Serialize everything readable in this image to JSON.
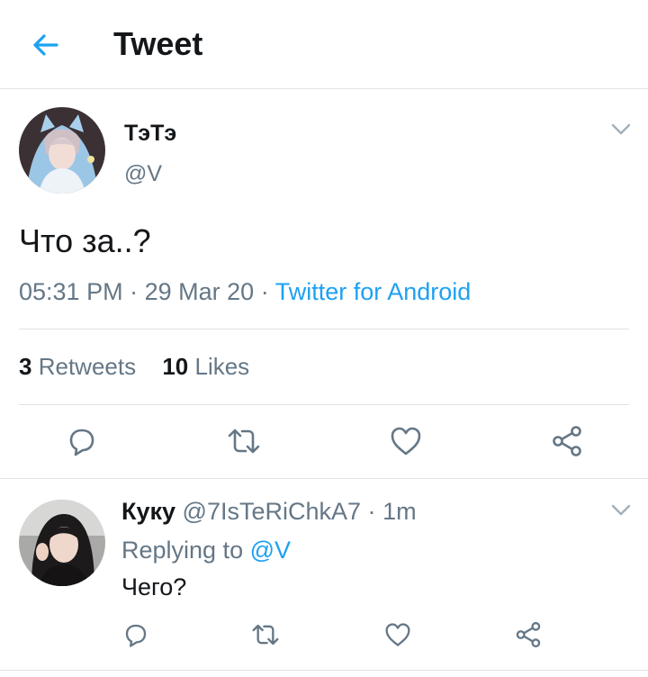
{
  "header": {
    "title": "Tweet",
    "back_icon": "arrow-left-icon"
  },
  "tweet": {
    "author": {
      "display_name": "ТэТэ",
      "handle": "@V"
    },
    "text": "Что за..?",
    "time": "05:31 PM",
    "separator": "·",
    "date": "29 Mar 20",
    "source": "Twitter for Android",
    "stats": {
      "retweets_count": "3",
      "retweets_label": "Retweets",
      "likes_count": "10",
      "likes_label": "Likes"
    },
    "actions": [
      "reply-icon",
      "retweet-icon",
      "like-icon",
      "share-icon"
    ]
  },
  "reply": {
    "author": {
      "display_name": "Куку",
      "handle": "@7IsTeRiChkA7"
    },
    "separator": "·",
    "time": "1m",
    "replying_label": "Replying to",
    "replying_to": "@V",
    "text": "Чего?",
    "actions": [
      "reply-icon",
      "retweet-icon",
      "like-icon",
      "share-icon"
    ]
  },
  "colors": {
    "accent": "#1da1f2",
    "secondary_text": "#657786",
    "primary_text": "#14171a",
    "divider": "#dfe3e6"
  }
}
